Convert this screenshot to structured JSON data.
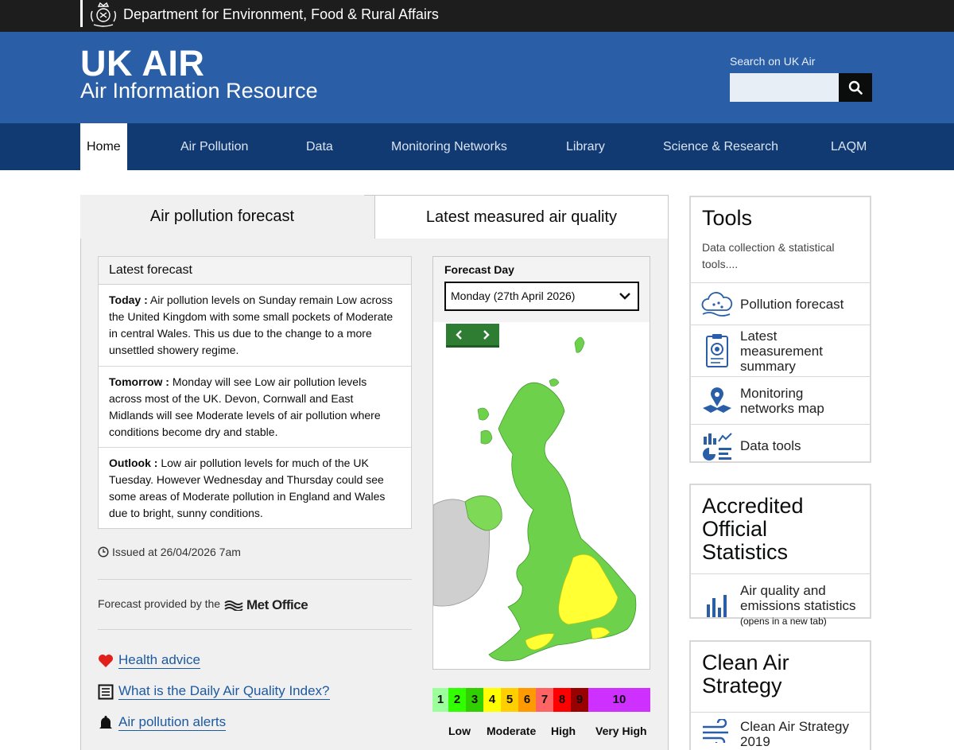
{
  "gov_bar": {
    "department": "Department for Environment, Food & Rural Affairs"
  },
  "header": {
    "title": "UK AIR",
    "subtitle": "Air Information Resource",
    "search_label": "Search on UK Air",
    "search_value": ""
  },
  "nav": {
    "items": [
      {
        "label": "Home",
        "active": true
      },
      {
        "label": "Air Pollution"
      },
      {
        "label": "Data"
      },
      {
        "label": "Monitoring Networks"
      },
      {
        "label": "Library"
      },
      {
        "label": "Science & Research"
      },
      {
        "label": "LAQM"
      }
    ]
  },
  "tabs": {
    "forecast": "Air pollution forecast",
    "measured": "Latest measured air quality"
  },
  "forecast": {
    "heading": "Latest forecast",
    "items": [
      {
        "label": "Today :",
        "text": " Air pollution levels on Sunday remain Low across the United Kingdom with some small pockets of Moderate in central Wales. This us due to the change to a more unsettled showery regime."
      },
      {
        "label": "Tomorrow :",
        "text": " Monday will see Low air pollution levels across most of the UK. Devon, Cornwall and East Midlands will see Moderate levels of air pollution where conditions become dry and stable."
      },
      {
        "label": "Outlook :",
        "text": " Low air pollution levels for much of the UK Tuesday. However Wednesday and Thursday could see some areas of Moderate pollution in England and Wales due to bright, sunny conditions."
      }
    ],
    "issued": "Issued at 26/04/2026 7am",
    "provided_by": "Forecast provided by the",
    "provider": "Met Office"
  },
  "links": {
    "health": "Health advice",
    "daqi": "What is the Daily Air Quality Index?",
    "alerts": "Air pollution alerts"
  },
  "map": {
    "forecast_day_label": "Forecast Day",
    "selected_day": "Monday (27th April 2026)"
  },
  "legend": {
    "bands": [
      {
        "value": "1",
        "color": "#9cff9c"
      },
      {
        "value": "2",
        "color": "#31ff00"
      },
      {
        "value": "3",
        "color": "#31cf00"
      },
      {
        "value": "4",
        "color": "#ffff00"
      },
      {
        "value": "5",
        "color": "#ffcf00"
      },
      {
        "value": "6",
        "color": "#ff9a00"
      },
      {
        "value": "7",
        "color": "#ff6464"
      },
      {
        "value": "8",
        "color": "#ff0000"
      },
      {
        "value": "9",
        "color": "#990000"
      },
      {
        "value": "10",
        "color": "#ce30ff"
      }
    ],
    "labels": {
      "low": "Low",
      "moderate": "Moderate",
      "high": "High",
      "very_high": "Very High"
    }
  },
  "tools": {
    "title": "Tools",
    "subtitle": "Data collection & statistical tools....",
    "items": [
      {
        "label": "Pollution forecast",
        "icon": "cloud-forecast-icon"
      },
      {
        "label": "Latest measurement summary",
        "icon": "clipboard-icon"
      },
      {
        "label": "Monitoring networks map",
        "icon": "map-pin-icon"
      },
      {
        "label": "Data tools",
        "icon": "chart-tools-icon"
      }
    ]
  },
  "stats": {
    "title": "Accredited Official Statistics",
    "item_label": "Air quality and emissions statistics",
    "item_note": "(opens in a new tab)"
  },
  "clean_air": {
    "title": "Clean Air Strategy",
    "item_label": "Clean Air Strategy 2019"
  }
}
